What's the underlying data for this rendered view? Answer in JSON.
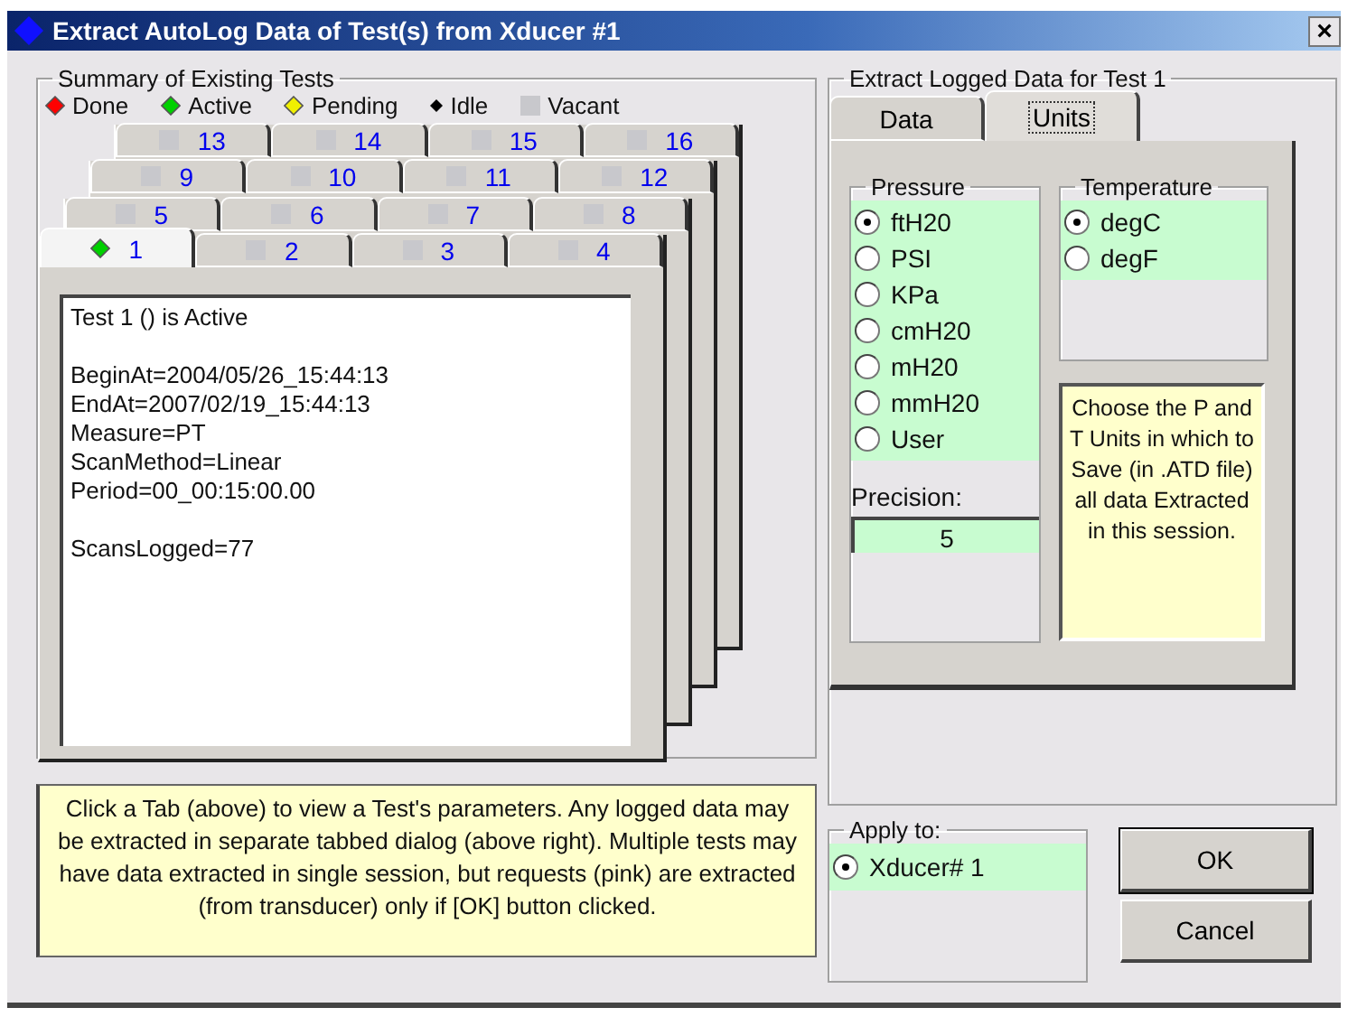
{
  "window": {
    "title": "Extract AutoLog Data of Test(s) from Xducer #1",
    "close": "×"
  },
  "summary": {
    "title": "Summary of Existing Tests",
    "legend": [
      {
        "label": "Done",
        "kind": "diamond",
        "color": "#ff0000"
      },
      {
        "label": "Active",
        "kind": "diamond",
        "color": "#00d000"
      },
      {
        "label": "Pending",
        "kind": "diamond",
        "color": "#f0f000"
      },
      {
        "label": "Idle",
        "kind": "dot",
        "color": "#000000"
      },
      {
        "label": "Vacant",
        "kind": "square",
        "color": "#c8c8cc"
      }
    ],
    "tab_rows": [
      {
        "tabs": [
          {
            "label": "13",
            "kind": "square",
            "color": "#c8c8cc",
            "selected": false
          },
          {
            "label": "14",
            "kind": "square",
            "color": "#c8c8cc",
            "selected": false
          },
          {
            "label": "15",
            "kind": "square",
            "color": "#c8c8cc",
            "selected": false
          },
          {
            "label": "16",
            "kind": "square",
            "color": "#c8c8cc",
            "selected": false
          }
        ]
      },
      {
        "tabs": [
          {
            "label": "9",
            "kind": "square",
            "color": "#c8c8cc",
            "selected": false
          },
          {
            "label": "10",
            "kind": "square",
            "color": "#c8c8cc",
            "selected": false
          },
          {
            "label": "11",
            "kind": "square",
            "color": "#c8c8cc",
            "selected": false
          },
          {
            "label": "12",
            "kind": "square",
            "color": "#c8c8cc",
            "selected": false
          }
        ]
      },
      {
        "tabs": [
          {
            "label": "5",
            "kind": "square",
            "color": "#c8c8cc",
            "selected": false
          },
          {
            "label": "6",
            "kind": "square",
            "color": "#c8c8cc",
            "selected": false
          },
          {
            "label": "7",
            "kind": "square",
            "color": "#c8c8cc",
            "selected": false
          },
          {
            "label": "8",
            "kind": "square",
            "color": "#c8c8cc",
            "selected": false
          }
        ]
      },
      {
        "tabs": [
          {
            "label": "1",
            "kind": "diamond",
            "color": "#00d000",
            "selected": true
          },
          {
            "label": "2",
            "kind": "square",
            "color": "#c8c8cc",
            "selected": false
          },
          {
            "label": "3",
            "kind": "square",
            "color": "#c8c8cc",
            "selected": false
          },
          {
            "label": "4",
            "kind": "square",
            "color": "#c8c8cc",
            "selected": false
          }
        ]
      }
    ],
    "details": [
      [
        "Test 1 () is Active"
      ],
      [
        "BeginAt=2004/05/26_15:44:13",
        "EndAt=2007/02/19_15:44:13",
        "Measure=PT",
        "ScanMethod=Linear",
        "Period=00_00:15:00.00"
      ],
      [
        "ScansLogged=77"
      ]
    ],
    "help": "Click a Tab (above) to view a Test's parameters.  Any logged data may be extracted in separate tabbed dialog (above right).  Multiple tests may have data extracted in single session, but requests (pink) are extracted (from transducer) only if [OK] button clicked."
  },
  "extract": {
    "title": "Extract Logged Data for Test 1",
    "tabs": [
      {
        "label": "Data",
        "selected": false
      },
      {
        "label": "Units",
        "selected": true
      }
    ],
    "pressure": {
      "title": "Pressure",
      "options": [
        {
          "label": "ftH20",
          "checked": true
        },
        {
          "label": "PSI",
          "checked": false
        },
        {
          "label": "KPa",
          "checked": false
        },
        {
          "label": "cmH20",
          "checked": false
        },
        {
          "label": "mH20",
          "checked": false
        },
        {
          "label": "mmH20",
          "checked": false
        },
        {
          "label": "User",
          "checked": false
        }
      ]
    },
    "precision": {
      "label": "Precision:",
      "value": "5"
    },
    "temperature": {
      "title": "Temperature",
      "options": [
        {
          "label": "degC",
          "checked": true
        },
        {
          "label": "degF",
          "checked": false
        }
      ]
    },
    "note": "Choose the P and T Units in which to Save (in .ATD file) all data Extracted in this session."
  },
  "apply_to": {
    "title": "Apply to:",
    "options": [
      {
        "label": "Xducer# 1",
        "checked": true
      }
    ]
  },
  "buttons": [
    {
      "label": "OK",
      "default": true
    },
    {
      "label": "Cancel",
      "default": false
    }
  ]
}
